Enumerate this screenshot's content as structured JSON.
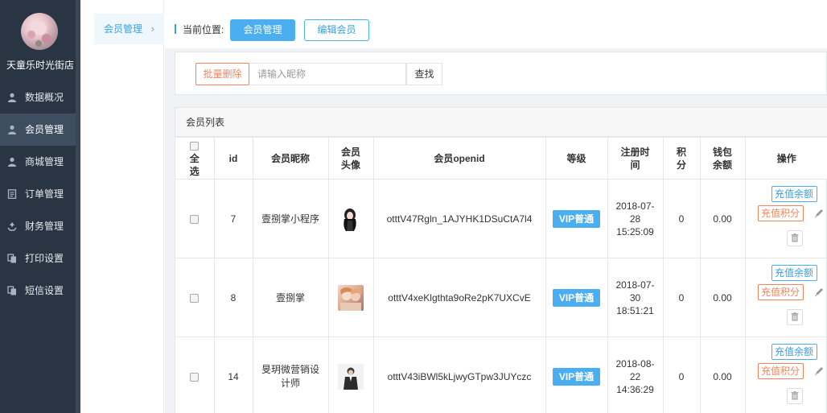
{
  "sidebar": {
    "store_name": "天童乐时光街店",
    "items": [
      {
        "label": "数据概况",
        "icon": "user-icon"
      },
      {
        "label": "会员管理",
        "icon": "user-icon",
        "active": true
      },
      {
        "label": "商城管理",
        "icon": "user-icon"
      },
      {
        "label": "订单管理",
        "icon": "document-icon"
      },
      {
        "label": "财务管理",
        "icon": "recycle-icon"
      },
      {
        "label": "打印设置",
        "icon": "copy-icon"
      },
      {
        "label": "短信设置",
        "icon": "copy-icon"
      }
    ]
  },
  "submenu": {
    "label": "会员管理",
    "chevron": "›"
  },
  "breadcrumb": {
    "label": "当前位置:",
    "btn_member": "会员管理",
    "btn_edit": "编辑会员"
  },
  "search": {
    "delete_label": "批量删除",
    "placeholder": "请输入昵称",
    "find_label": "查找"
  },
  "list": {
    "title": "会员列表",
    "headers": {
      "select_all": "全选",
      "id": "id",
      "nickname": "会员昵称",
      "avatar": "会员头像",
      "openid": "会员openid",
      "level": "等级",
      "reg_time": "注册时间",
      "points": "积分",
      "balance": "钱包余额",
      "ops": "操作"
    },
    "rows": [
      {
        "id": "7",
        "nickname": "壹捌掌小程序",
        "openid": "otttV47Rgln_1AJYHK1DSuCtA7l4",
        "level": "VIP普通",
        "reg_time": "2018-07-28 15:25:09",
        "points": "0",
        "balance": "0.00"
      },
      {
        "id": "8",
        "nickname": "壹捌掌",
        "openid": "otttV4xeKlgthta9oRe2pK7UXCvE",
        "level": "VIP普通",
        "reg_time": "2018-07-30 18:51:21",
        "points": "0",
        "balance": "0.00"
      },
      {
        "id": "14",
        "nickname": "旻玥微营销设计师",
        "openid": "otttV43iBWl5kLjwyGTpw3JUYczc",
        "level": "VIP普通",
        "reg_time": "2018-08-22 14:36:29",
        "points": "0",
        "balance": "0.00"
      }
    ],
    "ops": {
      "recharge": "充值余额",
      "points": "充值积分"
    }
  },
  "colors": {
    "accent": "#4aaef0",
    "danger": "#f0855d",
    "sidebar_bg": "#2a3543"
  }
}
